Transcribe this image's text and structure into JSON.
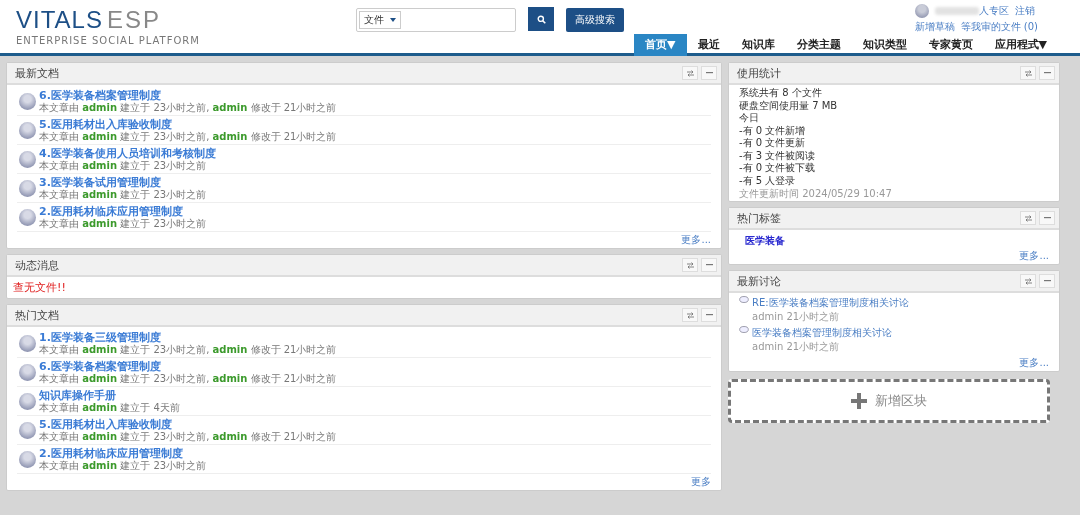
{
  "header": {
    "logo": {
      "brand": "VITALS",
      "product": "ESP",
      "tagline": "ENTERPRISE SOCIAL PLATFORM"
    },
    "search": {
      "scope": "文件",
      "advanced_button": "高级搜索"
    },
    "user": {
      "links": [
        "人专区",
        "注销"
      ],
      "sublinks": [
        "新增草稿",
        "等我审的文件 (0)"
      ]
    },
    "nav": [
      {
        "label": "首页▼",
        "selected": true
      },
      {
        "label": "最近",
        "selected": false
      },
      {
        "label": "知识库",
        "selected": false
      },
      {
        "label": "分类主题",
        "selected": false
      },
      {
        "label": "知识类型",
        "selected": false
      },
      {
        "label": "专家黄页",
        "selected": false
      },
      {
        "label": "应用程式▼",
        "selected": false
      }
    ]
  },
  "left_panels": [
    {
      "title": "最新文档",
      "kind": "docs",
      "items": [
        {
          "title": "6.医学装备档案管理制度",
          "meta": "本文章由 **admin** 建立于 23小时之前, **admin** 修改于 21小时之前"
        },
        {
          "title": "5.医用耗材出入库验收制度",
          "meta": "本文章由 **admin** 建立于 23小时之前, **admin** 修改于 21小时之前"
        },
        {
          "title": "4.医学装备使用人员培训和考核制度",
          "meta": "本文章由 **admin** 建立于 23小时之前"
        },
        {
          "title": "3.医学装备试用管理制度",
          "meta": "本文章由 **admin** 建立于 23小时之前"
        },
        {
          "title": "2.医用耗材临床应用管理制度",
          "meta": "本文章由 **admin** 建立于 23小时之前"
        }
      ],
      "more": "更多..."
    },
    {
      "title": "动态消息",
      "kind": "message",
      "text": "查无文件!!"
    },
    {
      "title": "热门文档",
      "kind": "docs",
      "items": [
        {
          "title": "1.医学装备三级管理制度",
          "meta": "本文章由 **admin** 建立于 23小时之前, **admin** 修改于 21小时之前"
        },
        {
          "title": "6.医学装备档案管理制度",
          "meta": "本文章由 **admin** 建立于 23小时之前, **admin** 修改于 21小时之前"
        },
        {
          "title": "知识库操作手册",
          "meta": "本文章由 **admin** 建立于 4天前"
        },
        {
          "title": "5.医用耗材出入库验收制度",
          "meta": "本文章由 **admin** 建立于 23小时之前, **admin** 修改于 21小时之前"
        },
        {
          "title": "2.医用耗材临床应用管理制度",
          "meta": "本文章由 **admin** 建立于 23小时之前"
        }
      ],
      "more": "更多"
    }
  ],
  "right_panels": [
    {
      "title": "使用统计",
      "kind": "stats",
      "lines": [
        "系统共有 8 个文件",
        "硬盘空间使用量 7 MB",
        "今日",
        "-有 0 文件新增",
        "-有 0 文件更新",
        "-有 3 文件被阅读",
        "-有 0 文件被下载",
        "-有 5 人登录"
      ],
      "updated": "文件更新时间 2024/05/29 10:47"
    },
    {
      "title": "热门标签",
      "kind": "tags",
      "tags": [
        "医学装备"
      ],
      "more": "更多..."
    },
    {
      "title": "最新讨论",
      "kind": "discussions",
      "items": [
        {
          "title": "RE:医学装备档案管理制度相关讨论",
          "meta": "admin 21小时之前"
        },
        {
          "title": "医学装备档案管理制度相关讨论",
          "meta": "admin 21小时之前"
        }
      ],
      "more": "更多..."
    }
  ],
  "add_block": "新增区块"
}
